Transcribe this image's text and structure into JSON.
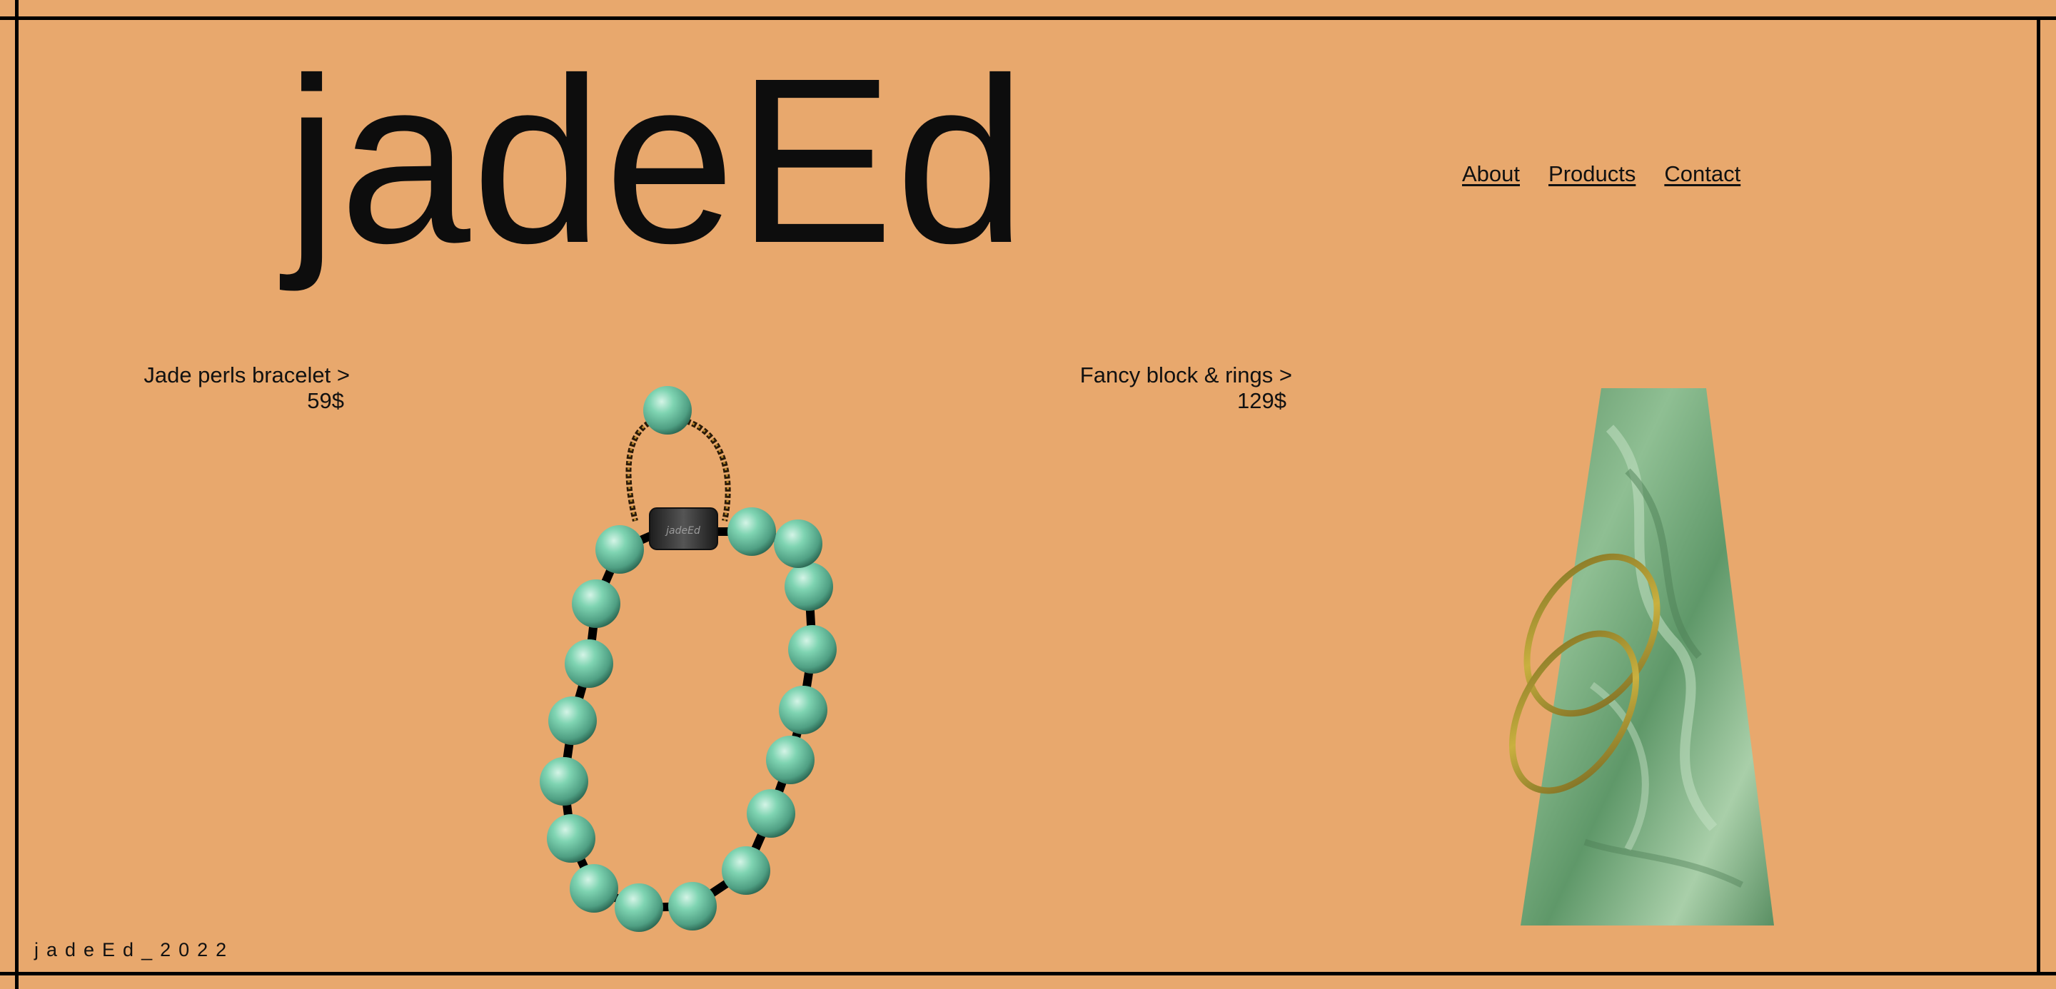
{
  "brand": {
    "logo": "jadeEd"
  },
  "nav": {
    "about": "About",
    "products": "Products",
    "contact": "Contact"
  },
  "products": [
    {
      "name": "Jade perls bracelet >",
      "price": "59$"
    },
    {
      "name": "Fancy block & rings >",
      "price": "129$"
    }
  ],
  "footer": {
    "text": "jadeEd_2022"
  },
  "colors": {
    "background": "#e8a86d",
    "jade": "#6fcaa8",
    "block_green": "#6c9c74",
    "ring_gold": "#9e8a2f",
    "text": "#111111"
  }
}
